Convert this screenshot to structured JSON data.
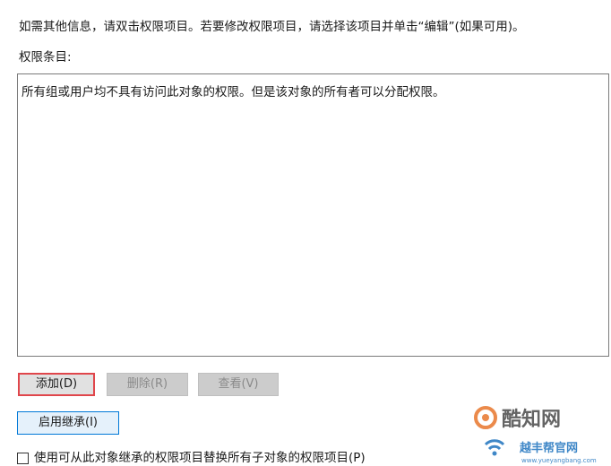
{
  "info_text": "如需其他信息，请双击权限项目。若要修改权限项目，请选择该项目并单击“编辑”(如果可用)。",
  "entries_label": "权限条目:",
  "empty_message": "所有组或用户均不具有访问此对象的权限。但是该对象的所有者可以分配权限。",
  "buttons": {
    "add": "添加(D)",
    "remove": "删除(R)",
    "view": "查看(V)",
    "enable_inheritance": "启用继承(I)"
  },
  "replace_checkbox": {
    "label": "使用可从此对象继承的权限项目替换所有子对象的权限项目(P)",
    "checked": false
  },
  "watermark": {
    "brand_main": "酷知网",
    "brand_sub": "越丰帮官网",
    "url": "www.yueyangbang.com",
    "accent_orange": "#e8762c",
    "accent_blue": "#1e73be"
  }
}
